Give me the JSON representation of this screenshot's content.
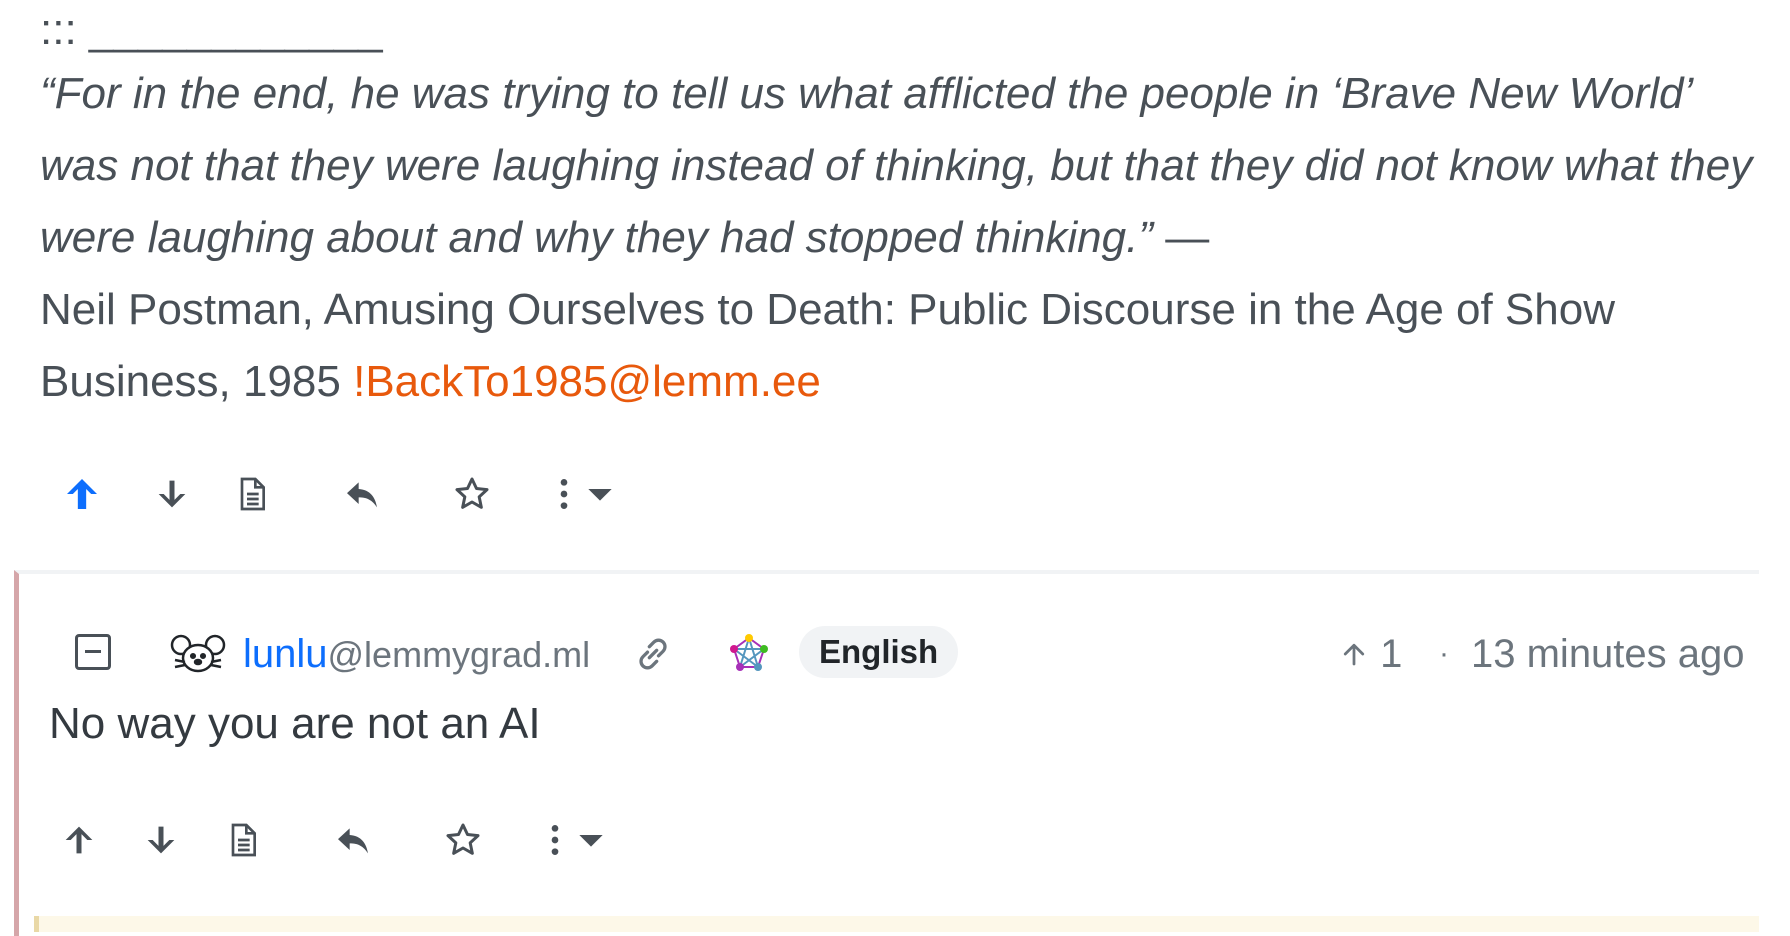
{
  "post": {
    "separator": "::: ____________",
    "quote_italic": "“For in the end, he was trying to tell us what afflicted the people in ‘Brave New World’ was not that they were laughing instead of thinking, but that they did not know what they were laughing about and why they had stopped thinking.”",
    "quote_dash": " —",
    "quote_attribution": "Neil Postman, Amusing Ourselves to Death: Public Discourse in the Age of Show Business, 1985 ",
    "community_link": "!BackTo1985@lemm.ee"
  },
  "comment": {
    "username": "lunlu",
    "instance": "@lemmygrad.ml",
    "language": "English",
    "score": "1",
    "separator": "·",
    "time": "13 minutes ago",
    "body": "No way you are not an AI"
  },
  "colors": {
    "upvote_active": "#0d6efd",
    "community_link": "#e8590c",
    "comment_border": "#d5a6a9"
  },
  "icons": [
    "arrow-up-icon",
    "arrow-down-icon",
    "document-icon",
    "reply-icon",
    "star-icon",
    "more-vertical-icon",
    "caret-down-icon",
    "link-icon",
    "fediverse-icon",
    "collapse-icon",
    "avatar-icon"
  ]
}
